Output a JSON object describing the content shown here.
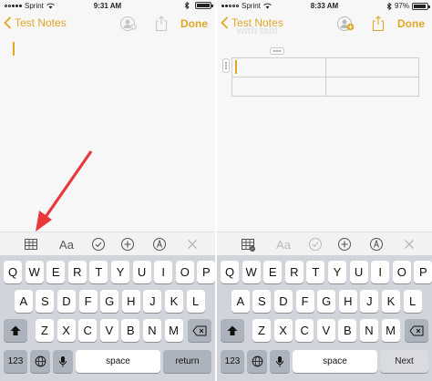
{
  "colors": {
    "accent": "#e2a626",
    "arrow": "#e8383b",
    "keyboard_bg": "#d1d4da"
  },
  "left": {
    "status": {
      "carrier": "Sprint",
      "time": "9:31 AM",
      "battery": "",
      "battery_level": 1.0
    },
    "nav": {
      "back_label": "Test Notes",
      "done_label": "Done"
    },
    "toolbar": [
      "table-icon",
      "text-style-icon",
      "checklist-icon",
      "add-icon",
      "sketch-icon",
      "close-icon"
    ],
    "toolbar_text": "Aa",
    "keys": {
      "row1": [
        "Q",
        "W",
        "E",
        "R",
        "T",
        "Y",
        "U",
        "I",
        "O",
        "P"
      ],
      "row2": [
        "A",
        "S",
        "D",
        "F",
        "G",
        "H",
        "J",
        "K",
        "L"
      ],
      "row3": [
        "Z",
        "X",
        "C",
        "V",
        "B",
        "N",
        "M"
      ],
      "numbers": "123",
      "space": "space",
      "return": "return"
    }
  },
  "right": {
    "status": {
      "carrier": "Sprint",
      "time": "8:33 AM",
      "battery": "97%",
      "battery_level": 0.97
    },
    "nav": {
      "back_label": "Test Notes",
      "done_label": "Done"
    },
    "ghost_title": "with tabl",
    "table": {
      "rows": 2,
      "cols": 2
    },
    "toolbar": [
      "table-icon",
      "text-style-icon",
      "checklist-icon",
      "add-icon",
      "sketch-icon",
      "close-icon"
    ],
    "toolbar_text": "Aa",
    "keys": {
      "row1": [
        "Q",
        "W",
        "E",
        "R",
        "T",
        "Y",
        "U",
        "I",
        "O",
        "P"
      ],
      "row2": [
        "A",
        "S",
        "D",
        "F",
        "G",
        "H",
        "J",
        "K",
        "L"
      ],
      "row3": [
        "Z",
        "X",
        "C",
        "V",
        "B",
        "N",
        "M"
      ],
      "numbers": "123",
      "space": "space",
      "next": "Next"
    }
  }
}
